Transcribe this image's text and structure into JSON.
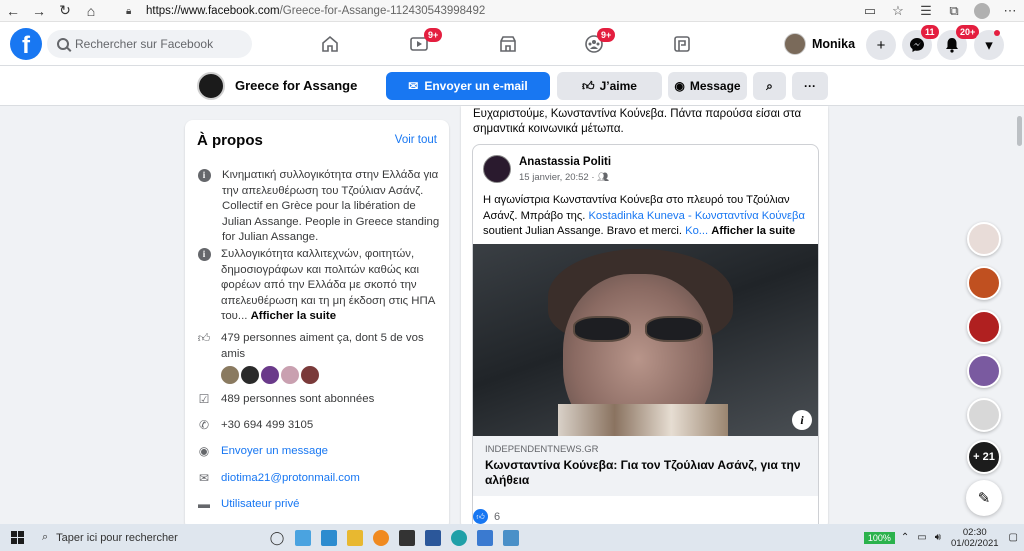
{
  "browser": {
    "url_domain": "https://www.facebook.com",
    "url_rest": "/Greece-for-Assange-112430543998492"
  },
  "fb_nav": {
    "search_placeholder": "Rechercher sur Facebook",
    "watch_badge": "9+",
    "groups_badge": "9+",
    "user_name": "Monika",
    "messenger_badge": "11",
    "notifications_badge": "20+"
  },
  "page_header": {
    "name": "Greece for Assange",
    "email_button": "Envoyer un e-mail",
    "like_button": "J’aime",
    "message_button": "Message"
  },
  "about": {
    "title": "À propos",
    "see_all": "Voir tout",
    "desc_1": "Κινηματική συλλογικότητα στην Ελλάδα για την απελευθέρωση του Τζούλιαν Ασάνζ. Collectif en Grèce pour la libération de Julian Assange. People in Greece standing for Julian Assange.",
    "desc_2": "Συλλογικότητα καλλιτεχνών, φοιτητών, δημοσιογράφων και πολιτών καθώς και φορέων από την Ελλάδα με σκοπό την απελευθέρωση και τη μη έκδοση στις ΗΠΑ του...",
    "see_more": "Afficher la suite",
    "likes": "479 personnes aiment ça, dont 5 de vos amis",
    "followers": "489 personnes sont abonnées",
    "phone": "+30 694 499 3105",
    "send_message": "Envoyer un message",
    "email": "diotima21@protonmail.com",
    "private_user": "Utilisateur privé"
  },
  "post": {
    "top_text": "Ευχαριστούμε, Κωνσταντίνα Κούνεβα. Πάντα παρούσα είσαι στα σημαντικά κοινωνικά μέτωπα.",
    "shared_author": "Anastassia Politi",
    "shared_time": "15 janvier, 20:52 ·",
    "shared_text_1": "Η αγωνίστρια  Κωνσταντίνα Κούνεβα στο πλευρό του Τζούλιαν Ασάνζ. Μπράβο της. ",
    "shared_mention": "Kostadinka Kuneva - Κωνσταντίνα Κούνεβα",
    "shared_text_2": " soutient Julian Assange. Bravo et merci. ",
    "shared_ko": "Ko...",
    "shared_see_more": "Afficher la suite",
    "link_domain": "INDEPENDENTNEWS.GR",
    "link_title": "Κωνσταντίνα Κούνεβα: Για τον Τζούλιαν Ασάνζ, για την αλήθεια",
    "reactions_count": "6"
  },
  "contacts": {
    "more_count": "+ 21"
  },
  "taskbar": {
    "search_placeholder": "Taper ici pour rechercher",
    "battery": "100%",
    "time": "02:30",
    "date": "01/02/2021"
  },
  "colors": {
    "fb_blue": "#1877f2",
    "badge_red": "#e41e3f",
    "background": "#f0f2f5"
  }
}
